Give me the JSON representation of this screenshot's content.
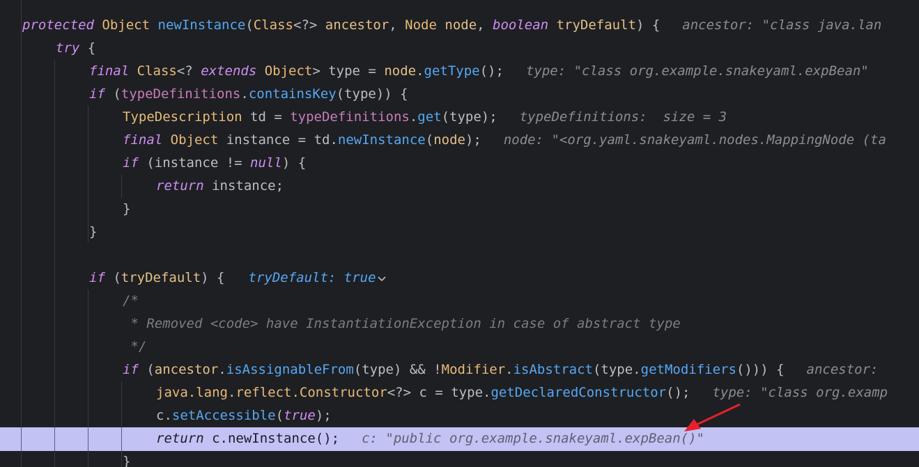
{
  "colors": {
    "background": "#1e1f22",
    "highlight": "#c2c2f5",
    "keyword": "#cf8ef4",
    "type": "#e8ba7a",
    "method": "#56a8f5",
    "field": "#c77dbb",
    "param": "#e3c08a",
    "plain": "#bcbec4",
    "comment": "#7a7e85",
    "hint": "#8a8d94",
    "arrow": "#e8202a"
  },
  "lines": [
    {
      "tokens": [
        {
          "t": "protected",
          "c": "keyword"
        },
        {
          "t": " "
        },
        {
          "t": "Object",
          "c": "type"
        },
        {
          "t": " "
        },
        {
          "t": "newInstance",
          "c": "method"
        },
        {
          "t": "("
        },
        {
          "t": "Class",
          "c": "type"
        },
        {
          "t": "<?> "
        },
        {
          "t": "ancestor",
          "c": "param"
        },
        {
          "t": ", "
        },
        {
          "t": "Node",
          "c": "type"
        },
        {
          "t": " "
        },
        {
          "t": "node",
          "c": "param"
        },
        {
          "t": ", "
        },
        {
          "t": "boolean",
          "c": "keyword"
        },
        {
          "t": " "
        },
        {
          "t": "tryDefault",
          "c": "param"
        },
        {
          "t": ") {"
        }
      ],
      "hint": "ancestor: \"class java.lan"
    },
    {
      "tokens": [
        {
          "t": "try",
          "c": "keyword"
        },
        {
          "t": " {"
        }
      ]
    },
    {
      "tokens": [
        {
          "t": "final",
          "c": "keyword"
        },
        {
          "t": " "
        },
        {
          "t": "Class",
          "c": "type"
        },
        {
          "t": "<? "
        },
        {
          "t": "extends",
          "c": "keyword"
        },
        {
          "t": " "
        },
        {
          "t": "Object",
          "c": "type"
        },
        {
          "t": "> type = "
        },
        {
          "t": "node",
          "c": "param"
        },
        {
          "t": "."
        },
        {
          "t": "getType",
          "c": "method"
        },
        {
          "t": "();"
        }
      ],
      "hint": "type: \"class org.example.snakeyaml.expBean\""
    },
    {
      "tokens": [
        {
          "t": "if",
          "c": "keyword"
        },
        {
          "t": " ("
        },
        {
          "t": "typeDefinitions",
          "c": "field"
        },
        {
          "t": "."
        },
        {
          "t": "containsKey",
          "c": "method"
        },
        {
          "t": "(type)) {"
        }
      ]
    },
    {
      "tokens": [
        {
          "t": "TypeDescription",
          "c": "type"
        },
        {
          "t": " td = "
        },
        {
          "t": "typeDefinitions",
          "c": "field"
        },
        {
          "t": "."
        },
        {
          "t": "get",
          "c": "method"
        },
        {
          "t": "(type);"
        }
      ],
      "hint": "typeDefinitions:  size = 3"
    },
    {
      "tokens": [
        {
          "t": "final",
          "c": "keyword"
        },
        {
          "t": " "
        },
        {
          "t": "Object",
          "c": "type"
        },
        {
          "t": " instance = td."
        },
        {
          "t": "newInstance",
          "c": "method"
        },
        {
          "t": "("
        },
        {
          "t": "node",
          "c": "param"
        },
        {
          "t": ");"
        }
      ],
      "hint": "node: \"<org.yaml.snakeyaml.nodes.MappingNode (ta"
    },
    {
      "tokens": [
        {
          "t": "if",
          "c": "keyword"
        },
        {
          "t": " (instance != "
        },
        {
          "t": "null",
          "c": "keyword"
        },
        {
          "t": ") {"
        }
      ]
    },
    {
      "tokens": [
        {
          "t": "return",
          "c": "keyword"
        },
        {
          "t": " instance;"
        }
      ]
    },
    {
      "tokens": [
        {
          "t": "}"
        }
      ]
    },
    {
      "tokens": [
        {
          "t": "}"
        }
      ]
    },
    {
      "tokens": []
    },
    {
      "tokens": [
        {
          "t": "if",
          "c": "keyword"
        },
        {
          "t": " ("
        },
        {
          "t": "tryDefault",
          "c": "param"
        },
        {
          "t": ") {"
        }
      ],
      "inline_value": {
        "label": "tryDefault:",
        "value": "true",
        "icon": "chevron-down-icon"
      }
    },
    {
      "tokens": [
        {
          "t": "/*",
          "c": "comment"
        }
      ]
    },
    {
      "tokens": [
        {
          "t": " * Removed <code> have InstantiationException in case of abstract type",
          "c": "comment"
        }
      ]
    },
    {
      "tokens": [
        {
          "t": " */",
          "c": "comment"
        }
      ]
    },
    {
      "tokens": [
        {
          "t": "if",
          "c": "keyword"
        },
        {
          "t": " ("
        },
        {
          "t": "ancestor",
          "c": "param"
        },
        {
          "t": "."
        },
        {
          "t": "isAssignableFrom",
          "c": "method"
        },
        {
          "t": "(type) && !"
        },
        {
          "t": "Modifier",
          "c": "type"
        },
        {
          "t": "."
        },
        {
          "t": "isAbstract",
          "c": "method"
        },
        {
          "t": "(type."
        },
        {
          "t": "getModifiers",
          "c": "method"
        },
        {
          "t": "())) {"
        }
      ],
      "hint": "ancestor: "
    },
    {
      "tokens": [
        {
          "t": "java.lang.reflect.Constructor",
          "c": "type"
        },
        {
          "t": "<?> c = type."
        },
        {
          "t": "getDeclaredConstructor",
          "c": "method"
        },
        {
          "t": "();"
        }
      ],
      "hint": "type: \"class org.examp"
    },
    {
      "tokens": [
        {
          "t": "c."
        },
        {
          "t": "setAccessible",
          "c": "method"
        },
        {
          "t": "("
        },
        {
          "t": "true",
          "c": "keyword"
        },
        {
          "t": ");"
        }
      ]
    },
    {
      "tokens": [
        {
          "t": "return",
          "c": "keyword"
        },
        {
          "t": " c.newInstance();"
        }
      ],
      "hint": "c: \"public org.example.snakeyaml.expBean()\"",
      "highlighted": true
    },
    {
      "tokens": [
        {
          "t": "}"
        }
      ]
    }
  ]
}
